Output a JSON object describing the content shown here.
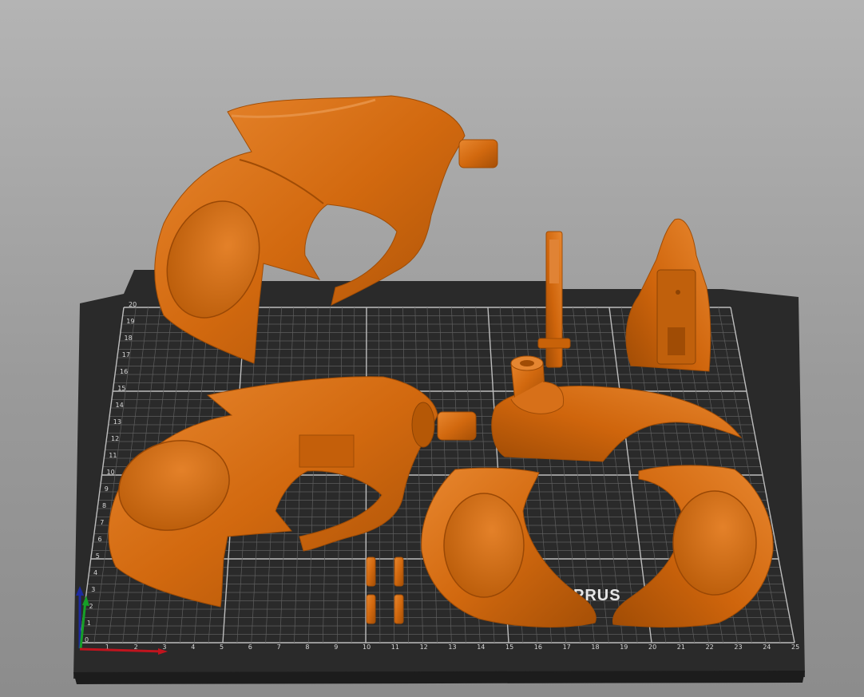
{
  "bed": {
    "x_ticks": [
      "1",
      "2",
      "3",
      "4",
      "5",
      "6",
      "7",
      "8",
      "9",
      "10",
      "11",
      "12",
      "13",
      "14",
      "15",
      "16",
      "17",
      "18",
      "19",
      "20",
      "21",
      "22",
      "23",
      "24",
      "25"
    ],
    "y_ticks": [
      "0",
      "1",
      "2",
      "3",
      "4",
      "5",
      "6",
      "7",
      "8",
      "9",
      "10",
      "11",
      "12",
      "13",
      "14",
      "15",
      "16",
      "17",
      "18",
      "19",
      "20"
    ],
    "logo": "PRUS"
  },
  "colors": {
    "part": "#d2690f",
    "part_dark": "#a04c05",
    "part_light": "#e88a36",
    "bed": "#262626",
    "grid": "#777777",
    "axis_x": "#c0141e",
    "axis_y": "#16a028",
    "axis_z": "#1c2aa0"
  },
  "objects": [
    {
      "name": "grip-left-upper"
    },
    {
      "name": "grip-left-lower"
    },
    {
      "name": "hammer-arm"
    },
    {
      "name": "barrel-cap"
    },
    {
      "name": "trigger-swoop"
    },
    {
      "name": "side-plate-left"
    },
    {
      "name": "side-plate-right"
    },
    {
      "name": "pin-1"
    },
    {
      "name": "pin-2"
    },
    {
      "name": "pin-3"
    },
    {
      "name": "pin-4"
    }
  ]
}
